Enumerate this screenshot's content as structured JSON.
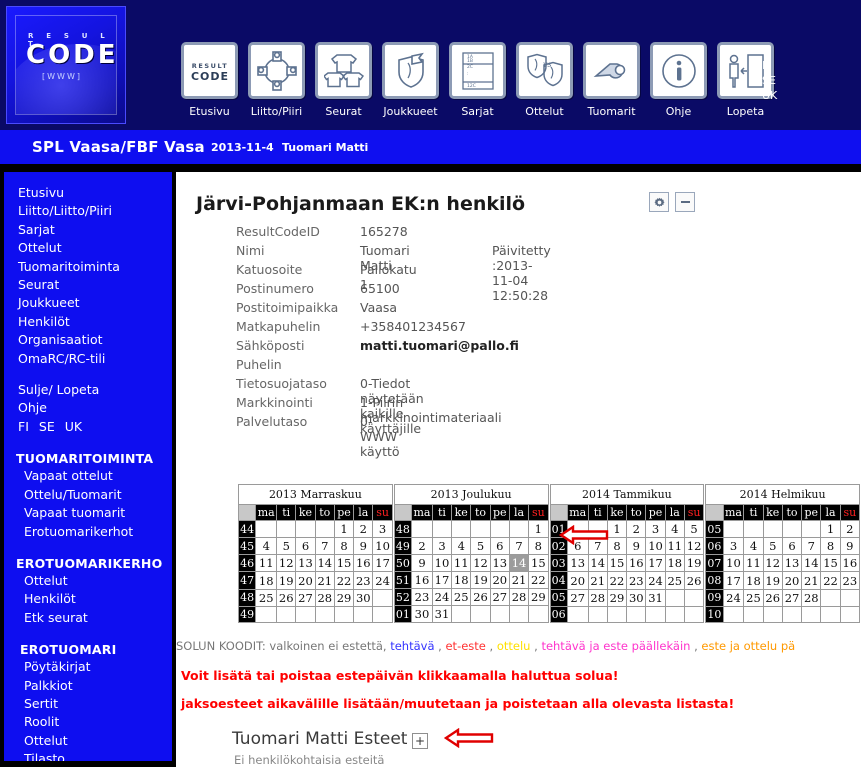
{
  "header": {
    "logo": {
      "result": "R E S U L T",
      "code": "CODE",
      "www": "[WWW]"
    },
    "nav": [
      {
        "label": "Etusivu",
        "icon": "resultcode-logo-icon"
      },
      {
        "label": "Liitto/Piiri",
        "icon": "network-nodes-icon"
      },
      {
        "label": "Seurat",
        "icon": "jerseys-icon"
      },
      {
        "label": "Joukkueet",
        "icon": "shield-flag-icon"
      },
      {
        "label": "Sarjat",
        "icon": "standings-list-icon"
      },
      {
        "label": "Ottelut",
        "icon": "shield-vs-shield-icon"
      },
      {
        "label": "Tuomarit",
        "icon": "whistle-icon"
      },
      {
        "label": "Ohje",
        "icon": "info-circle-icon"
      },
      {
        "label": "Lopeta",
        "icon": "exit-door-icon"
      }
    ],
    "languages": [
      "FI",
      "SE",
      "UK"
    ]
  },
  "titlestrip": {
    "organization": "SPL Vaasa/FBF Vasa",
    "date": "2013-11-4",
    "user": "Tuomari Matti"
  },
  "sidebar": {
    "primary": [
      "Etusivu",
      "Liitto/Liitto/Piiri",
      "Sarjat",
      "Ottelut",
      "Tuomaritoiminta",
      "Seurat",
      "Joukkueet",
      "Henkilöt",
      "Organisaatiot",
      "OmaRC/RC-tili"
    ],
    "secondary": [
      "Sulje/ Lopeta",
      "Ohje"
    ],
    "languages": [
      "FI",
      "SE",
      "UK"
    ],
    "groups": [
      {
        "heading": "TUOMARITOIMINTA",
        "items": [
          "Vapaat ottelut",
          "Ottelu/Tuomarit",
          "Vapaat tuomarit",
          "Erotuomarikerhot"
        ]
      },
      {
        "heading": "EROTUOMARIKERHO",
        "items": [
          "Ottelut",
          "Henkilöt",
          "Etk seurat"
        ]
      },
      {
        "heading": "EROTUOMARI",
        "items": [
          "Pöytäkirjat",
          "Palkkiot",
          "Sertit",
          "Roolit",
          "Ottelut",
          "Tilasto"
        ]
      }
    ]
  },
  "main": {
    "page_title": "Järvi-Pohjanmaan EK:n henkilö",
    "tools": {
      "settings_icon": "gear-icon",
      "collapse_icon": "minus-icon"
    },
    "details": [
      {
        "key": "ResultCodeID",
        "value": "165278"
      },
      {
        "key": "Nimi",
        "value": "Tuomari Matti",
        "extra": "Päivitetty :2013-11-04 12:50:28"
      },
      {
        "key": "Katuosoite",
        "value": "Pallokatu 1"
      },
      {
        "key": "Postinumero",
        "value": "65100"
      },
      {
        "key": "Postitoimipaikka",
        "value": "Vaasa"
      },
      {
        "key": "Matkapuhelin",
        "value": "+358401234567"
      },
      {
        "key": "Sähköposti",
        "value": "matti.tuomari@pallo.fi",
        "bold": true
      },
      {
        "key": "Puhelin",
        "value": ""
      },
      {
        "key": "Tietosuojataso",
        "value": "0-Tiedot näytetään kaikille käyttäjille"
      },
      {
        "key": "Markkinointi",
        "value": "1-Piirin markkinointimateriaali"
      },
      {
        "key": "Palvelutaso",
        "value": "0-WWW käyttö"
      }
    ],
    "calendar": {
      "weekday_headers": [
        "ma",
        "ti",
        "ke",
        "to",
        "pe",
        "la",
        "su"
      ],
      "months": [
        {
          "caption": "2013 Marraskuu",
          "weeks": [
            {
              "wk": "44",
              "days": [
                "",
                "",
                "",
                "",
                "1",
                "2",
                "3"
              ]
            },
            {
              "wk": "45",
              "days": [
                "4",
                "5",
                "6",
                "7",
                "8",
                "9",
                "10"
              ]
            },
            {
              "wk": "46",
              "days": [
                "11",
                "12",
                "13",
                "14",
                "15",
                "16",
                "17"
              ]
            },
            {
              "wk": "47",
              "days": [
                "18",
                "19",
                "20",
                "21",
                "22",
                "23",
                "24"
              ]
            },
            {
              "wk": "48",
              "days": [
                "25",
                "26",
                "27",
                "28",
                "29",
                "30",
                ""
              ]
            },
            {
              "wk": "49",
              "days": [
                "",
                "",
                "",
                "",
                "",
                "",
                ""
              ]
            }
          ]
        },
        {
          "caption": "2013 Joulukuu",
          "weeks": [
            {
              "wk": "48",
              "days": [
                "",
                "",
                "",
                "",
                "",
                "",
                "1"
              ]
            },
            {
              "wk": "49",
              "days": [
                "2",
                "3",
                "4",
                "5",
                "6",
                "7",
                "8"
              ]
            },
            {
              "wk": "50",
              "days": [
                "9",
                "10",
                "11",
                "12",
                "13",
                "14",
                "15"
              ],
              "selected": 5
            },
            {
              "wk": "51",
              "days": [
                "16",
                "17",
                "18",
                "19",
                "20",
                "21",
                "22"
              ]
            },
            {
              "wk": "52",
              "days": [
                "23",
                "24",
                "25",
                "26",
                "27",
                "28",
                "29"
              ]
            },
            {
              "wk": "01",
              "days": [
                "30",
                "31",
                "",
                "",
                "",
                "",
                ""
              ]
            }
          ]
        },
        {
          "caption": "2014 Tammikuu",
          "weeks": [
            {
              "wk": "01",
              "days": [
                "",
                "",
                "1",
                "2",
                "3",
                "4",
                "5"
              ]
            },
            {
              "wk": "02",
              "days": [
                "6",
                "7",
                "8",
                "9",
                "10",
                "11",
                "12"
              ]
            },
            {
              "wk": "03",
              "days": [
                "13",
                "14",
                "15",
                "16",
                "17",
                "18",
                "19"
              ]
            },
            {
              "wk": "04",
              "days": [
                "20",
                "21",
                "22",
                "23",
                "24",
                "25",
                "26"
              ]
            },
            {
              "wk": "05",
              "days": [
                "27",
                "28",
                "29",
                "30",
                "31",
                "",
                ""
              ]
            },
            {
              "wk": "06",
              "days": [
                "",
                "",
                "",
                "",
                "",
                "",
                ""
              ]
            }
          ]
        },
        {
          "caption": "2014 Helmikuu",
          "weeks": [
            {
              "wk": "05",
              "days": [
                "",
                "",
                "",
                "",
                "",
                "1",
                "2"
              ]
            },
            {
              "wk": "06",
              "days": [
                "3",
                "4",
                "5",
                "6",
                "7",
                "8",
                "9"
              ]
            },
            {
              "wk": "07",
              "days": [
                "10",
                "11",
                "12",
                "13",
                "14",
                "15",
                "16"
              ]
            },
            {
              "wk": "08",
              "days": [
                "17",
                "18",
                "19",
                "20",
                "21",
                "22",
                "23"
              ]
            },
            {
              "wk": "09",
              "days": [
                "24",
                "25",
                "26",
                "27",
                "28",
                "",
                ""
              ]
            },
            {
              "wk": "10",
              "days": [
                "",
                "",
                "",
                "",
                "",
                "",
                ""
              ]
            }
          ]
        }
      ]
    },
    "legend": {
      "prefix": "SOLUN KOODIT: valkoinen ei estettä,",
      "items": [
        {
          "label": "tehtävä",
          "color": "#3333ff"
        },
        {
          "label": "et-este",
          "color": "#ff3333"
        },
        {
          "label": "ottelu",
          "color": "#ffe000"
        },
        {
          "label": "tehtävä ja este päällekäin",
          "color": "#ff33cc"
        },
        {
          "label": "este ja ottelu pä",
          "color": "#ff9900"
        }
      ]
    },
    "notes": [
      "Voit lisätä tai poistaa estepäivän klikkaamalla haluttua solua!",
      "jaksoesteet aikavälille lisätään/muutetaan ja poistetaan alla olevasta listasta!"
    ],
    "obstacles": {
      "title": "Tuomari Matti Esteet",
      "add_label": "+",
      "empty_text": "Ei henkilökohtaisia esteitä"
    }
  },
  "colors": {
    "banner": "#0a0a66",
    "strip": "#0f0ff0",
    "sidebar": "#0e0ef0",
    "accent_red": "#ff0000",
    "selected_cell": "#9c9c9c"
  }
}
